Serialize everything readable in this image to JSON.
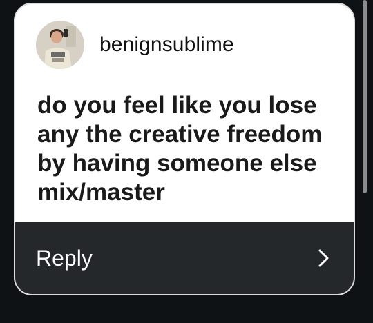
{
  "post": {
    "username": "benignsublime",
    "question": "do you feel like you lose any the creative freedom by having someone else mix/master"
  },
  "reply": {
    "label": "Reply",
    "icon": "chevron-right-icon"
  },
  "colors": {
    "page_background": "#0f1214",
    "card_background": "#ffffff",
    "reply_bar_background": "#25282b",
    "card_border": "#dcdcdc"
  }
}
